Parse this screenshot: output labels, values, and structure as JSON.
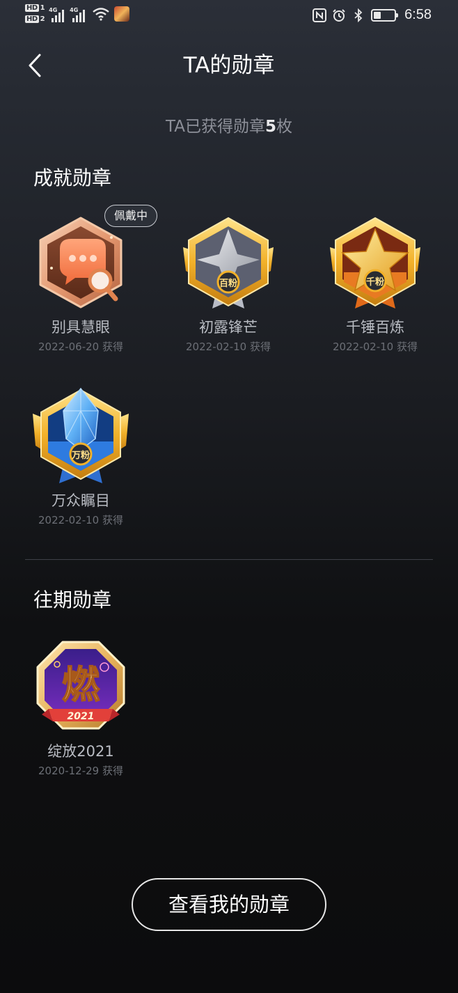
{
  "status_bar": {
    "hd1": "HD",
    "hd1_sub": "1",
    "hd2": "HD",
    "hd2_sub": "2",
    "net1": "4G",
    "net2": "4G",
    "time": "6:58",
    "battery_level": 0.35,
    "icons": [
      "wifi-icon",
      "game-app-icon",
      "nfc-icon",
      "alarm-icon",
      "bluetooth-icon",
      "battery-icon"
    ]
  },
  "header": {
    "title": "TA的勋章",
    "back_icon": "chevron-left-icon"
  },
  "summary": {
    "prefix": "TA已获得勋章",
    "count": "5",
    "suffix": "枚"
  },
  "achievement_section": {
    "title": "成就勋章",
    "wearing_tag": "佩戴中",
    "badges": [
      {
        "name": "别具慧眼",
        "date": "2022-06-20 获得",
        "icon": "chat-magnifier-badge-icon",
        "emblem_text": ""
      },
      {
        "name": "初露锋芒",
        "date": "2022-02-10 获得",
        "icon": "silver-star-badge-icon",
        "emblem_text": "百粉"
      },
      {
        "name": "千锤百炼",
        "date": "2022-02-10 获得",
        "icon": "gold-star-badge-icon",
        "emblem_text": "千粉"
      },
      {
        "name": "万众瞩目",
        "date": "2022-02-10 获得",
        "icon": "diamond-badge-icon",
        "emblem_text": "万粉"
      }
    ]
  },
  "past_section": {
    "title": "往期勋章",
    "badges": [
      {
        "name": "绽放2021",
        "date": "2020-12-29 获得",
        "icon": "ran-2021-badge-icon",
        "emblem_text": "燃",
        "ribbon_text": "2021"
      }
    ]
  },
  "footer": {
    "button_label": "查看我的勋章"
  },
  "colors": {
    "gold": "#f2b12a",
    "copper": "#e8885a",
    "silver": "#c9ccd2",
    "diamond": "#4fa3f0",
    "purple": "#6a2fb8"
  }
}
